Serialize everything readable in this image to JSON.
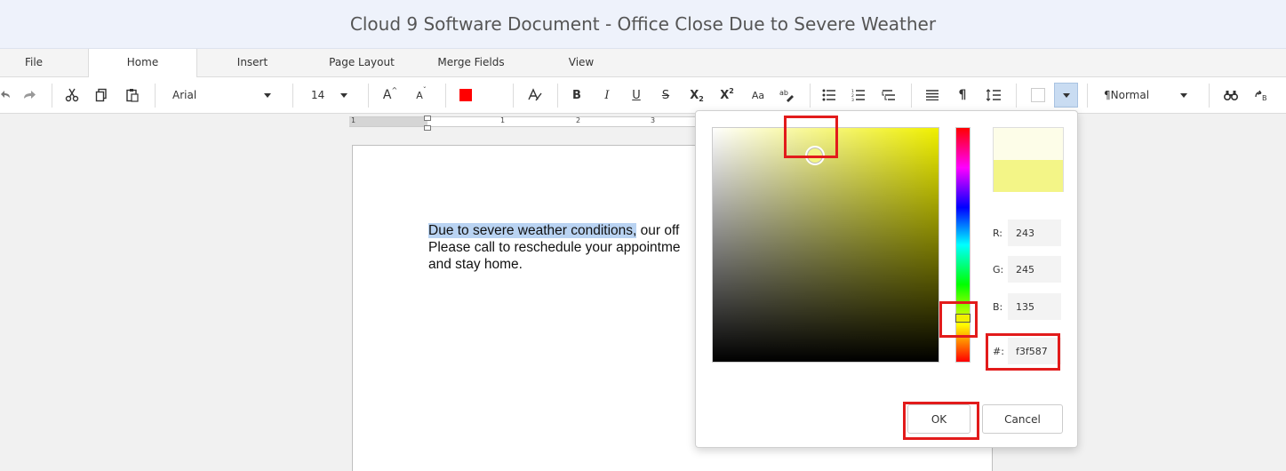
{
  "window": {
    "title": "Cloud 9 Software Document - Office Close Due to Severe Weather"
  },
  "tabs": [
    {
      "label": "File"
    },
    {
      "label": "Home"
    },
    {
      "label": "Insert"
    },
    {
      "label": "Page Layout"
    },
    {
      "label": "Merge Fields"
    },
    {
      "label": "View"
    }
  ],
  "toolbar": {
    "font_name": "Arial",
    "font_size": "14",
    "style_name": "¶Normal",
    "font_color": "#ff0000",
    "grow_font_icon": "A",
    "shrink_font_icon": "A",
    "bold_icon": "B",
    "italic_icon": "I",
    "underline_icon": "U",
    "strike_icon": "S",
    "subscript_icon": "X",
    "superscript_icon": "X",
    "case_icon": "Aa",
    "pilcrow_icon": "¶"
  },
  "ruler": {
    "numbers": [
      "1",
      "1",
      "2",
      "3"
    ]
  },
  "document": {
    "line1_highlighted": "Due to severe weather conditions,",
    "line1_rest": " our off",
    "line2": "Please call to reschedule your appointme",
    "line3": "and stay home."
  },
  "color_picker": {
    "r_label": "R:",
    "r_value": "243",
    "g_label": "G:",
    "g_value": "245",
    "b_label": "B:",
    "b_value": "135",
    "hex_label": "#:",
    "hex_value": "f3f587",
    "selected_color": "#f3f587",
    "hue_color": "#f0f000",
    "ok_label": "OK",
    "cancel_label": "Cancel"
  }
}
